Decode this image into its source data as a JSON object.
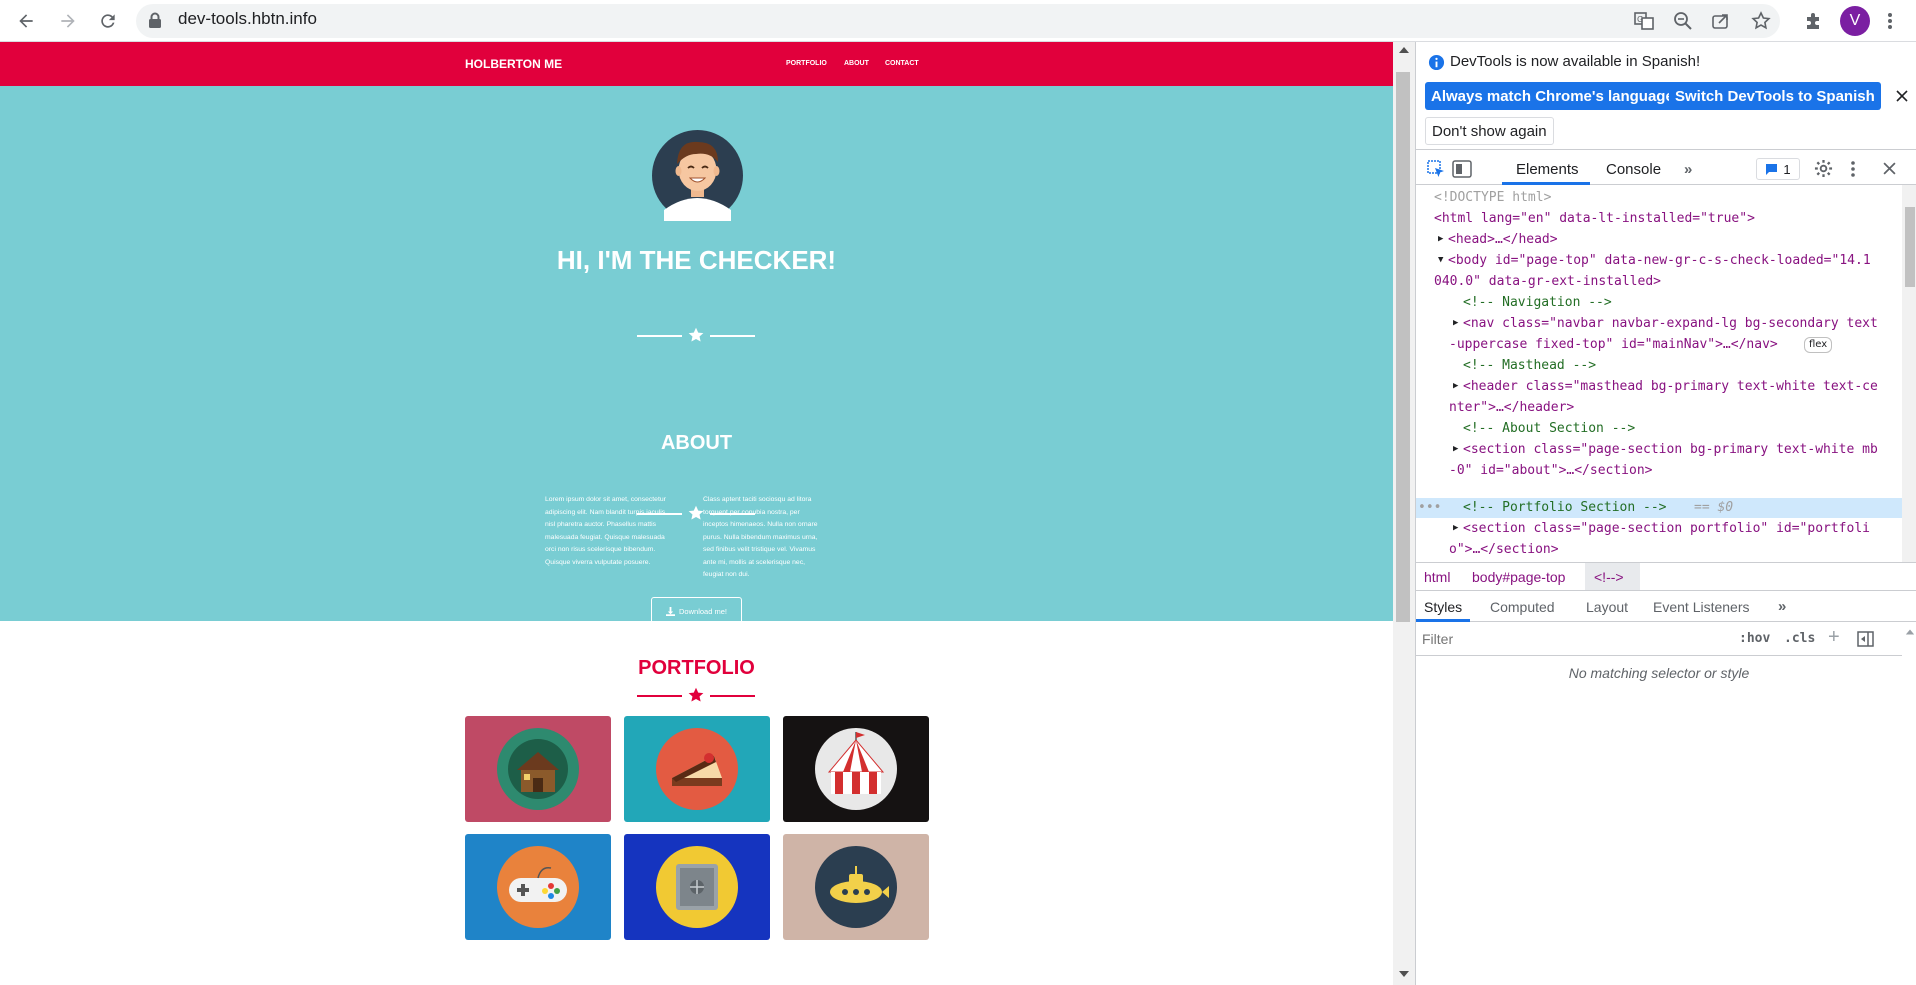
{
  "browser": {
    "url": "dev-tools.hbtn.info",
    "avatar_letter": "V"
  },
  "site": {
    "brand": "HOLBERTON ME",
    "nav": [
      "PORTFOLIO",
      "ABOUT",
      "CONTACT"
    ],
    "hero_title": "HI, I'M THE CHECKER!",
    "about_title": "ABOUT",
    "about_left": [
      "Lorem ipsum dolor sit amet, consectetur",
      "adipiscing elit. Nam blandit turpis iaculis",
      "nisl pharetra auctor. Phasellus mattis",
      "malesuada feugiat. Quisque malesuada",
      "orci non risus scelerisque bibendum.",
      "Quisque viverra vulputate posuere."
    ],
    "about_right": [
      "Class aptent taciti sociosqu ad litora",
      "torquent per conubia nostra, per",
      "inceptos himenaeos. Nulla non ornare",
      "purus. Nulla bibendum maximus urna,",
      "sed finibus velit tristique vel. Vivamus",
      "ante mi, mollis at scelerisque nec,",
      "feugiat non dui."
    ],
    "download_label": "Download me!",
    "portfolio_title": "PORTFOLIO",
    "portfolio_items": [
      {
        "icon": "cabin-icon",
        "bg": "#bf4a65"
      },
      {
        "icon": "cake-icon",
        "bg": "#22a7b8"
      },
      {
        "icon": "circus-tent-icon",
        "bg": "#151212"
      },
      {
        "icon": "game-controller-icon",
        "bg": "#1f84c8"
      },
      {
        "icon": "safe-icon",
        "bg": "#1534bf"
      },
      {
        "icon": "submarine-icon",
        "bg": "#cfb4a7"
      }
    ]
  },
  "devtools": {
    "info_text": "DevTools is now available in Spanish!",
    "btn_match": "Always match Chrome's language",
    "btn_switch": "Switch DevTools to Spanish",
    "btn_dont_show": "Don't show again",
    "tabs": [
      "Elements",
      "Console"
    ],
    "issues_count": "1",
    "breadcrumbs": [
      "html",
      "body#page-top",
      "<!-->"
    ],
    "styles_tabs": [
      "Styles",
      "Computed",
      "Layout",
      "Event Listeners"
    ],
    "filter_placeholder": "Filter",
    "hov": ":hov",
    "cls": ".cls",
    "no_match": "No matching selector or style",
    "dom_lines": {
      "doctype": "<!DOCTYPE html>",
      "html_open": "<html lang=\"en\" data-lt-installed=\"true\">",
      "head": "<head>…</head>",
      "body_1": "<body id=\"page-top\" data-new-gr-c-s-check-loaded=\"14.1",
      "body_2": "040.0\" data-gr-ext-installed>",
      "c_nav": "<!-- Navigation -->",
      "nav_1": "<nav class=\"navbar navbar-expand-lg bg-secondary text",
      "nav_2": "-uppercase fixed-top\" id=\"mainNav\">…</nav>",
      "flex": "flex",
      "c_masthead": "<!-- Masthead -->",
      "header_1": "<header class=\"masthead bg-primary text-white text-ce",
      "header_2": "nter\">…</header>",
      "c_about": "<!-- About Section -->",
      "section_1": "<section class=\"page-section bg-primary text-white mb",
      "section_2": "-0\" id=\"about\">…</section>",
      "c_portfolio": "<!-- Portfolio Section -->",
      "eq_dollar": "== $0",
      "psection_1": "<section class=\"page-section portfolio\" id=\"portfoli",
      "psection_2": "o\">…</section>"
    }
  }
}
